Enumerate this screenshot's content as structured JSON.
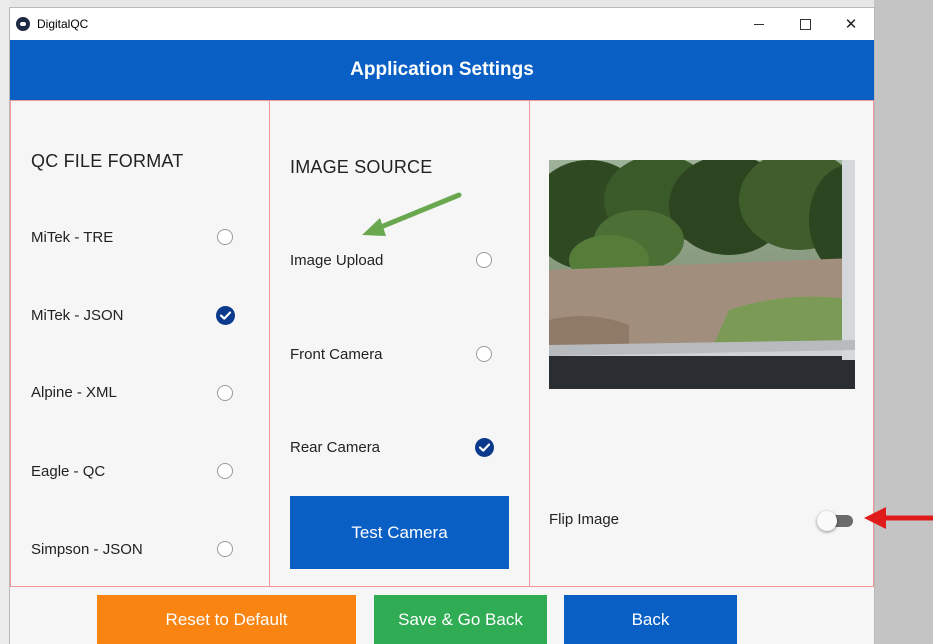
{
  "window": {
    "title": "DigitalQC",
    "minimize_icon": "minimize-icon",
    "maximize_icon": "maximize-icon",
    "close_icon": "close-icon"
  },
  "header": {
    "title": "Application Settings"
  },
  "qc_file_format": {
    "title": "QC FILE FORMAT",
    "options": [
      {
        "label": "MiTek - TRE",
        "selected": false
      },
      {
        "label": "MiTek - JSON",
        "selected": true
      },
      {
        "label": "Alpine - XML",
        "selected": false
      },
      {
        "label": "Eagle - QC",
        "selected": false
      },
      {
        "label": "Simpson - JSON",
        "selected": false
      }
    ]
  },
  "image_source": {
    "title": "IMAGE SOURCE",
    "options": [
      {
        "label": "Image Upload",
        "selected": false
      },
      {
        "label": "Front Camera",
        "selected": false
      },
      {
        "label": "Rear Camera",
        "selected": true
      }
    ],
    "test_button": "Test Camera"
  },
  "preview": {
    "flip_label": "Flip Image",
    "flip_enabled": false
  },
  "buttons": {
    "reset": "Reset to Default",
    "save": "Save & Go Back",
    "back": "Back"
  },
  "colors": {
    "primary": "#0a5fc5",
    "reset": "#fa8412",
    "save": "#2fac54",
    "check": "#0b3a8c",
    "panel_border": "#f0989a",
    "annotation_green": "#6aa84f",
    "annotation_red": "#e01b1b"
  }
}
